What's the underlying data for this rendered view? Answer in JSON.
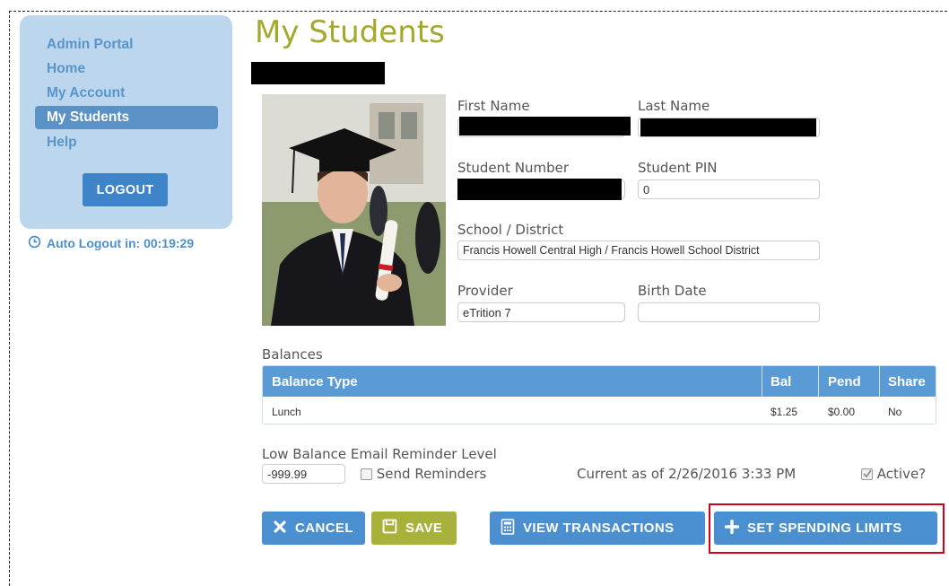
{
  "sidebar": {
    "items": [
      {
        "label": "Admin Portal"
      },
      {
        "label": "Home"
      },
      {
        "label": "My Account"
      },
      {
        "label": "My Students"
      },
      {
        "label": "Help"
      }
    ],
    "logout_label": "LOGOUT",
    "auto_logout": "Auto Logout in: 00:19:29"
  },
  "page": {
    "title": "My Students"
  },
  "form": {
    "first_name_label": "First Name",
    "last_name_label": "Last Name",
    "student_number_label": "Student Number",
    "student_pin_label": "Student PIN",
    "student_pin_value": "0",
    "school_label": "School / District",
    "school_value": "Francis Howell Central High / Francis Howell School District",
    "provider_label": "Provider",
    "provider_value": "eTrition 7",
    "birth_date_label": "Birth Date",
    "birth_date_value": ""
  },
  "balances": {
    "section_label": "Balances",
    "columns": [
      "Balance Type",
      "Bal",
      "Pend",
      "Share"
    ],
    "rows": [
      {
        "type": "Lunch",
        "bal": "$1.25",
        "pend": "$0.00",
        "share": "No"
      }
    ]
  },
  "reminder": {
    "label": "Low Balance Email Reminder Level",
    "value": "-999.99",
    "send_label": "Send Reminders",
    "current_as_of": "Current as of 2/26/2016 3:33 PM",
    "active_label": "Active?"
  },
  "buttons": {
    "cancel": "CANCEL",
    "save": "SAVE",
    "view_transactions": "VIEW TRANSACTIONS",
    "set_spending_limits": "SET SPENDING LIMITS"
  },
  "colors": {
    "accent_blue": "#4a8fd0",
    "title_olive": "#a4a92c",
    "save_olive": "#a8b23a",
    "sidebar_bg": "#bcd6ee",
    "highlight_red": "#d0021b"
  },
  "icons": [
    "clock-icon",
    "close-icon",
    "save-icon",
    "calculator-icon",
    "plus-icon"
  ]
}
